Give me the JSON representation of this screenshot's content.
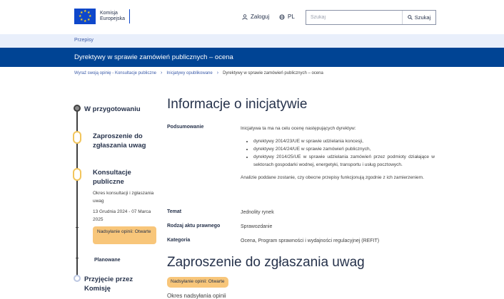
{
  "header": {
    "logo_line1": "Komisja",
    "logo_line2": "Europejska",
    "login_label": "Zaloguj",
    "lang_label": "PL",
    "search_placeholder": "Szukaj",
    "search_button": "Szukaj"
  },
  "subnav": {
    "link": "Przepisy"
  },
  "banner": {
    "title": "Dyrektywy w sprawie zamówień publicznych – ocena"
  },
  "breadcrumb": {
    "items": [
      "Wyraź swoją opinię - Konsultacje publiczne",
      "Inicjatywy opublikowane",
      "Dyrektywy w sprawie zamówień publicznych – ocena"
    ]
  },
  "timeline": {
    "stage1": "W przygotowaniu",
    "stage2": "Zaproszenie do zgłaszania uwag",
    "stage3": "Konsultacje publiczne",
    "period_label": "Okres konsultacji i zgłaszania uwag",
    "period_dates": "13 Grudnia 2024 - 07 Marca 2025",
    "badge": "Nadsyłanie opinii: Otwarte",
    "stage4": "Planowane",
    "stage5": "Przyjęcie przez Komisję"
  },
  "main": {
    "heading": "Informacje o inicjatywie",
    "summary_label": "Podsumowanie",
    "summary_intro": "Inicjatywa ta ma na celu ocenę następujących dyrektyw:",
    "summary_items": [
      "dyrektywy 2014/23/UE w sprawie udzielania koncesji,",
      "dyrektywy 2014/24/UE w sprawie zamówień publicznych,",
      "dyrektywy 2014/25/UE w sprawie udzielania zamówień przez podmioty działające w sektorach gospodarki wodnej, energetyki, transportu i usług pocztowych."
    ],
    "summary_outro": "Analizie poddane zostanie, czy obecne przepisy funkcjonują zgodnie z ich zamierzeniem.",
    "topic_label": "Temat",
    "topic_value": "Jednolity rynek",
    "act_label": "Rodzaj aktu prawnego",
    "act_value": "Sprawozdanie",
    "category_label": "Kategoria",
    "category_value": "Ocena, Program sprawności i wydajności regulacyjnej (REFIT)",
    "heading2": "Zaproszenie do zgłaszania uwag",
    "badge2": "Nadsyłanie opinii: Otwarte",
    "cut_text": "Okres nadsyłania opinii"
  },
  "colors": {
    "brand_blue": "#004494",
    "badge_orange": "#f8c67a",
    "link_blue": "#3a5aa8"
  }
}
